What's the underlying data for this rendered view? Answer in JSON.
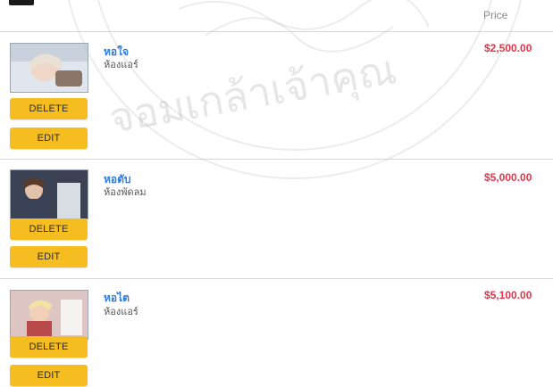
{
  "header": {
    "price_label": "Price"
  },
  "watermark_text": "จอมเกล้าเจ้าคุณ",
  "colors": {
    "accent_button": "#f5bd1f",
    "link_blue": "#2b7be0",
    "price_red": "#e5344a"
  },
  "rooms": [
    {
      "name": "หอใจ",
      "type": "ห้องแอร์",
      "price": "$2,500.00",
      "delete_label": "DELETE",
      "edit_label": "EDIT",
      "image": "room-photo"
    },
    {
      "name": "หอตับ",
      "type": "ห้องพัดลม",
      "price": "$5,000.00",
      "delete_label": "DELETE",
      "edit_label": "EDIT",
      "image": "room-photo"
    },
    {
      "name": "หอไต",
      "type": "ห้องแอร์",
      "price": "$5,100.00",
      "delete_label": "DELETE",
      "edit_label": "EDIT",
      "image": "room-photo"
    }
  ]
}
